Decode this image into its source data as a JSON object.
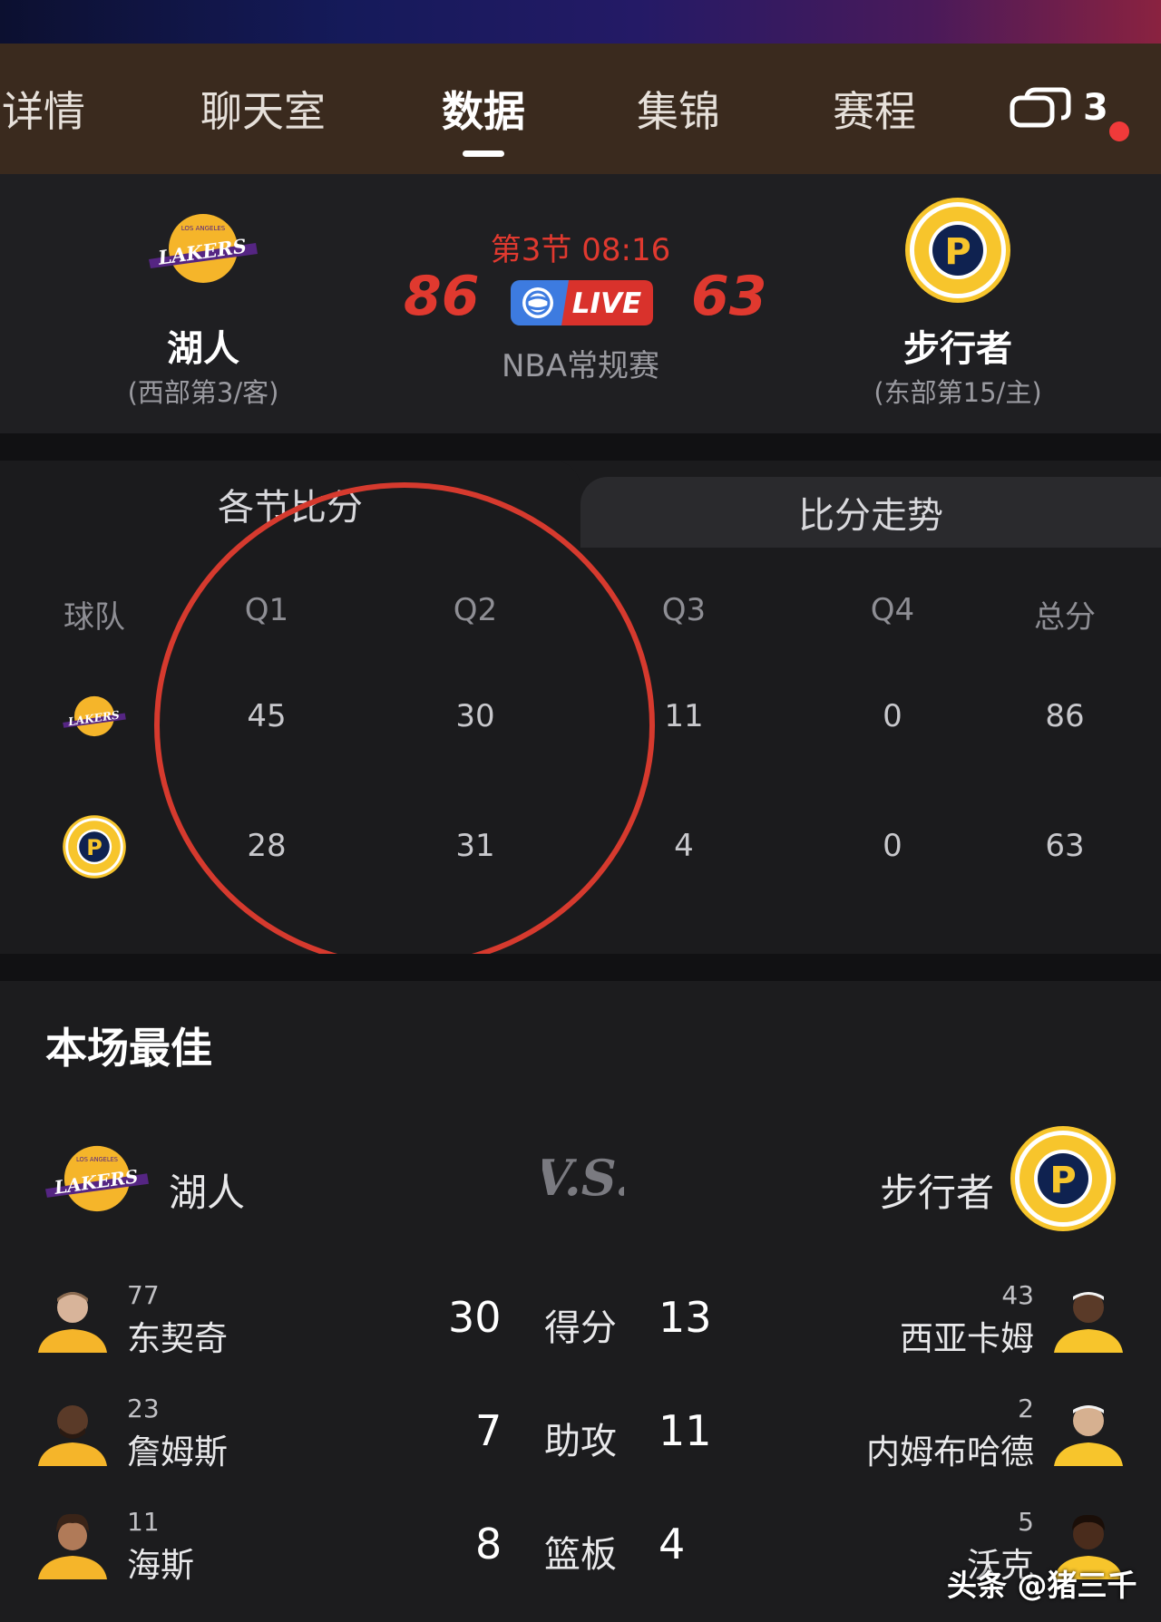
{
  "nav": {
    "tabs": [
      {
        "label": "详情"
      },
      {
        "label": "聊天室"
      },
      {
        "label": "数据"
      },
      {
        "label": "集锦"
      },
      {
        "label": "赛程"
      }
    ],
    "active_tab": "数据",
    "message_count": "3"
  },
  "match": {
    "away": {
      "name": "湖人",
      "sub": "(西部第3/客)",
      "score": "86",
      "logo": "lakers-logo"
    },
    "home": {
      "name": "步行者",
      "sub": "(东部第15/主)",
      "score": "63",
      "logo": "pacers-logo"
    },
    "period": "第3节 08:16",
    "live_label": "LIVE",
    "league": "NBA常规赛"
  },
  "quarters": {
    "tabs": [
      "各节比分",
      "比分走势"
    ],
    "headers": [
      "球队",
      "Q1",
      "Q2",
      "Q3",
      "Q4",
      "总分"
    ],
    "rows": [
      {
        "team": "lakers-logo",
        "q1": "45",
        "q2": "30",
        "q3": "11",
        "q4": "0",
        "total": "86"
      },
      {
        "team": "pacers-logo",
        "q1": "28",
        "q2": "31",
        "q3": "4",
        "q4": "0",
        "total": "63"
      }
    ]
  },
  "best": {
    "title": "本场最佳",
    "left_team": "湖人",
    "right_team": "步行者",
    "vs": "V.S.",
    "rows": [
      {
        "label": "得分",
        "left": {
          "number": "77",
          "name": "东契奇",
          "value": "30"
        },
        "right": {
          "number": "43",
          "name": "西亚卡姆",
          "value": "13"
        }
      },
      {
        "label": "助攻",
        "left": {
          "number": "23",
          "name": "詹姆斯",
          "value": "7"
        },
        "right": {
          "number": "2",
          "name": "内姆布哈德",
          "value": "11"
        }
      },
      {
        "label": "篮板",
        "left": {
          "number": "11",
          "name": "海斯",
          "value": "8"
        },
        "right": {
          "number": "5",
          "name": "沃克",
          "value": "4"
        }
      }
    ]
  },
  "watermark": "头条 @猪三千",
  "colors": {
    "accent_red": "#e0392f",
    "nav_bg": "#3a2a1e",
    "lakers_gold": "#f5b52a",
    "lakers_purple": "#552583",
    "pacers_navy": "#0f2250"
  }
}
